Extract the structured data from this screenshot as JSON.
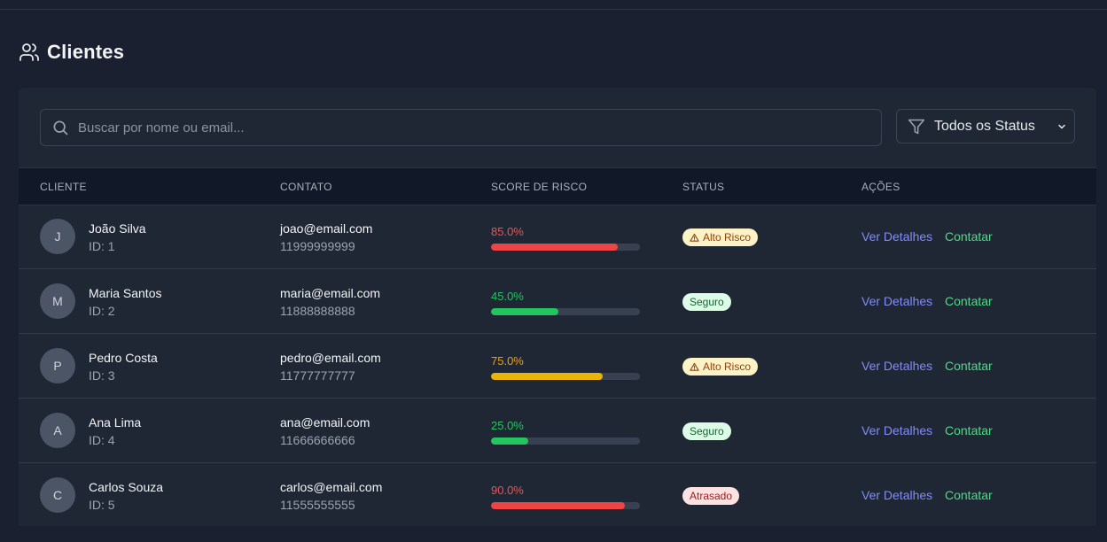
{
  "page": {
    "title": "Clientes",
    "title_icon": "users-icon"
  },
  "search": {
    "placeholder": "Buscar por nome ou email...",
    "value": "",
    "icon": "search-icon"
  },
  "filter": {
    "icon": "filter-icon",
    "selected": "Todos os Status",
    "chevron_icon": "chevron-down-icon"
  },
  "table": {
    "headers": [
      "CLIENTE",
      "CONTATO",
      "SCORE DE RISCO",
      "STATUS",
      "AÇÕES"
    ],
    "rows": [
      {
        "initial": "J",
        "name": "João Silva",
        "id_label": "ID: 1",
        "email": "joao@email.com",
        "phone": "11999999999",
        "score_label": "85.0%",
        "score": 0.85,
        "status": "Alto Risco",
        "status_type": "warning",
        "details_label": "Ver Detalhes",
        "contact_label": "Contatar"
      },
      {
        "initial": "M",
        "name": "Maria Santos",
        "id_label": "ID: 2",
        "email": "maria@email.com",
        "phone": "11888888888",
        "score_label": "45.0%",
        "score": 0.45,
        "status": "Seguro",
        "status_type": "safe",
        "details_label": "Ver Detalhes",
        "contact_label": "Contatar"
      },
      {
        "initial": "P",
        "name": "Pedro Costa",
        "id_label": "ID: 3",
        "email": "pedro@email.com",
        "phone": "11777777777",
        "score_label": "75.0%",
        "score": 0.75,
        "status": "Alto Risco",
        "status_type": "warning",
        "details_label": "Ver Detalhes",
        "contact_label": "Contatar"
      },
      {
        "initial": "A",
        "name": "Ana Lima",
        "id_label": "ID: 4",
        "email": "ana@email.com",
        "phone": "11666666666",
        "score_label": "25.0%",
        "score": 0.25,
        "status": "Seguro",
        "status_type": "safe",
        "details_label": "Ver Detalhes",
        "contact_label": "Contatar"
      },
      {
        "initial": "C",
        "name": "Carlos Souza",
        "id_label": "ID: 5",
        "email": "carlos@email.com",
        "phone": "11555555555",
        "score_label": "90.0%",
        "score": 0.9,
        "status": "Atrasado",
        "status_type": "late",
        "details_label": "Ver Detalhes",
        "contact_label": "Contatar"
      }
    ]
  },
  "colors": {
    "score_high": "#ef4444",
    "score_medium": "#eab308",
    "score_low": "#22c55e",
    "score_text_high": "#f05252",
    "score_text_medium": "#f59e0b",
    "score_text_low": "#22c55e",
    "badge_warning_bg": "#fef3c7",
    "badge_warning_fg": "#92400e",
    "badge_safe_bg": "#dcfce7",
    "badge_safe_fg": "#166534",
    "badge_late_bg": "#fee2e2",
    "badge_late_fg": "#991b1b"
  }
}
